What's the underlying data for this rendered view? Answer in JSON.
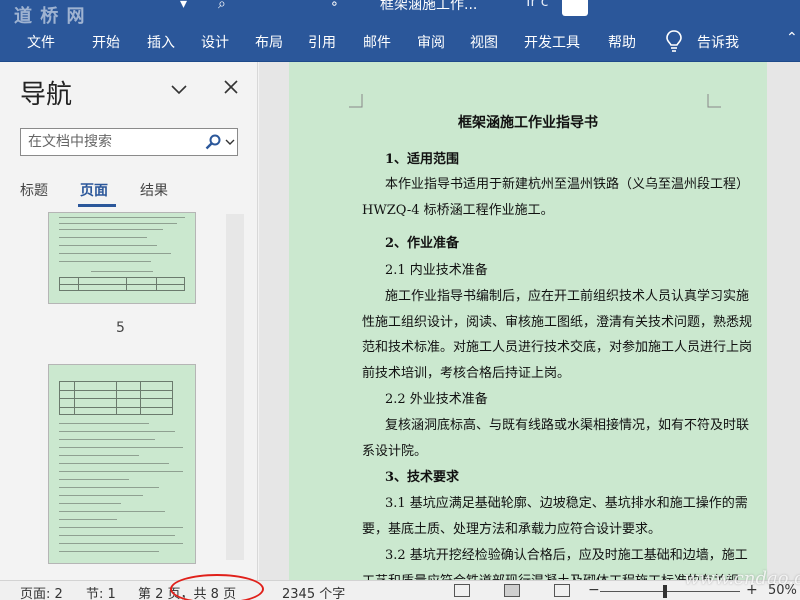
{
  "watermark_top": "道 桥 网",
  "watermark_bottom": "www.cndao.com",
  "titlebar": {
    "title": "框架涵施工作...",
    "user": "Tr c"
  },
  "ribbon": {
    "tabs": [
      "文件",
      "开始",
      "插入",
      "设计",
      "布局",
      "引用",
      "邮件",
      "审阅",
      "视图",
      "开发工具",
      "帮助"
    ],
    "tell_me": "告诉我"
  },
  "nav": {
    "title": "导航",
    "search_placeholder": "在文档中搜索",
    "tabs": [
      "标题",
      "页面",
      "结果"
    ],
    "active_tab": "页面",
    "page_label": "5"
  },
  "doc": {
    "title": "框架涵施工作业指导书",
    "lines": [
      "1、适用范围",
      "本作业指导书适用于新建杭州至温州铁路（义乌至温州段工程）",
      "HWZQ-4 标桥涵工程作业施工。",
      "2、作业准备",
      "2.1 内业技术准备",
      "施工作业指导书编制后，应在开工前组织技术人员认真学习实施",
      "性施工组织设计，阅读、审核施工图纸，澄清有关技术问题，熟悉规",
      "范和技术标准。对施工人员进行技术交底，对参加施工人员进行上岗",
      "前技术培训，考核合格后持证上岗。",
      "2.2 外业技术准备",
      "复核涵洞底标高、与既有线路或水渠相接情况，如有不符及时联",
      "系设计院。",
      "3、技术要求",
      "3.1 基坑应满足基础轮廓、边坡稳定、基坑排水和施工操作的需",
      "要，基底土质、处理方法和承载力应符合设计要求。",
      "3.2 基坑开挖经检验确认合格后，应及时施工基础和边墙，施工",
      "工艺和质量应符合铁道部现行混凝土及砌体工程施工标准的有关规"
    ]
  },
  "status": {
    "page": "页面: 2",
    "section": "节: 1",
    "page_of": "第 2 页，共 8 页",
    "words": "2345 个字",
    "zoom": "50%"
  },
  "colors": {
    "ribbon": "#2b579a",
    "page_bg": "#cbe8cf",
    "highlight_ring": "#e0201a"
  }
}
